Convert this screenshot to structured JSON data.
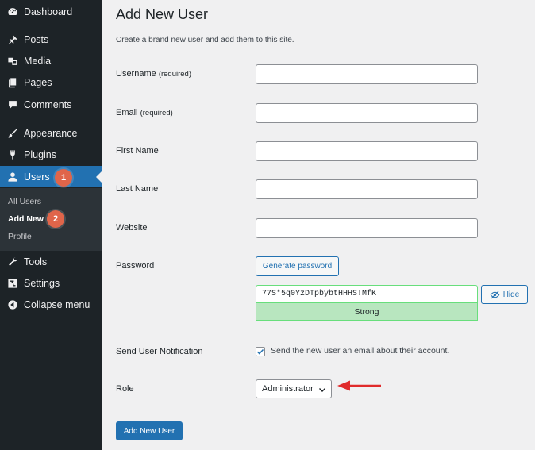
{
  "sidebar": {
    "items": [
      {
        "label": "Dashboard",
        "icon": "dashboard-icon"
      },
      {
        "label": "Posts",
        "icon": "pin-icon"
      },
      {
        "label": "Media",
        "icon": "media-icon"
      },
      {
        "label": "Pages",
        "icon": "pages-icon"
      },
      {
        "label": "Comments",
        "icon": "comment-icon"
      },
      {
        "label": "Appearance",
        "icon": "brush-icon"
      },
      {
        "label": "Plugins",
        "icon": "plugin-icon"
      },
      {
        "label": "Users",
        "icon": "user-icon"
      },
      {
        "label": "Tools",
        "icon": "wrench-icon"
      },
      {
        "label": "Settings",
        "icon": "settings-icon"
      },
      {
        "label": "Collapse menu",
        "icon": "collapse-icon"
      }
    ],
    "users_submenu": [
      "All Users",
      "Add New",
      "Profile"
    ],
    "badges": [
      "1",
      "2"
    ]
  },
  "page": {
    "title": "Add New User",
    "description": "Create a brand new user and add them to this site."
  },
  "form": {
    "username_label": "Username",
    "email_label": "Email",
    "required": "(required)",
    "first_name_label": "First Name",
    "last_name_label": "Last Name",
    "website_label": "Website",
    "password_label": "Password",
    "generate_password": "Generate password",
    "password_value": "77S*5q0YzDTpbybtHHHS!MfK",
    "hide_label": "Hide",
    "strength": "Strong",
    "notification_label": "Send User Notification",
    "notification_text": "Send the new user an email about their account.",
    "role_label": "Role",
    "role_value": "Administrator",
    "submit": "Add New User"
  },
  "colors": {
    "sidebar_bg": "#1d2327",
    "accent": "#2271b1",
    "badge": "#e0654a",
    "strong": "#b8e6bf",
    "arrow": "#e02b2b"
  }
}
